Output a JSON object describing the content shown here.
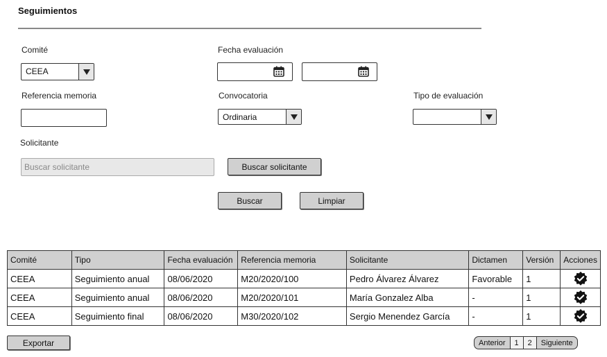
{
  "page": {
    "title": "Seguimientos"
  },
  "form": {
    "comite": {
      "label": "Comité",
      "value": "CEEA"
    },
    "fecha": {
      "label": "Fecha evaluación"
    },
    "referencia": {
      "label": "Referencia memoria"
    },
    "convocatoria": {
      "label": "Convocatoria",
      "value": "Ordinaria"
    },
    "tipo": {
      "label": "Tipo de evaluación",
      "value": ""
    },
    "solicitante": {
      "label": "Solicitante",
      "placeholder": "Buscar solicitante",
      "button": "Buscar solicitante"
    },
    "buscar_button": "Buscar",
    "limpiar_button": "Limpiar"
  },
  "table": {
    "headers": [
      "Comité",
      "Tipo",
      "Fecha evaluación",
      "Referencia memoria",
      "Solicitante",
      "Dictamen",
      "Versión",
      "Acciones"
    ],
    "rows": [
      [
        "CEEA",
        "Seguimiento anual",
        "08/06/2020",
        "M20/2020/100",
        "Pedro Álvarez Álvarez",
        "Favorable",
        "1"
      ],
      [
        "CEEA",
        "Seguimiento anual",
        "08/06/2020",
        "M20/2020/101",
        "María Gonzalez Alba",
        "-",
        "1"
      ],
      [
        "CEEA",
        "Seguimiento final",
        "08/06/2020",
        "M30/2020/102",
        "Sergio Menendez García",
        "-",
        "1"
      ]
    ],
    "action_icon": "verified-badge-icon"
  },
  "footer": {
    "export_button": "Exportar",
    "pager": {
      "prev": "Anterior",
      "pages": [
        "1",
        "2"
      ],
      "next": "Siguiente"
    }
  }
}
